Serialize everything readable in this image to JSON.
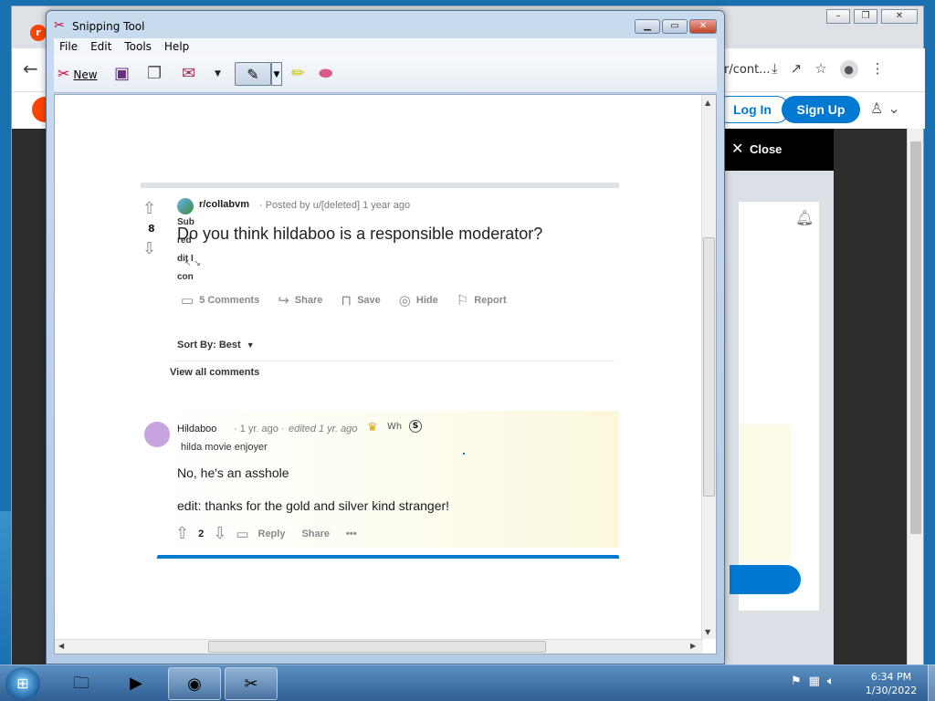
{
  "browser": {
    "url_tail": "r/cont...",
    "login_label": "Log In",
    "signup_label": "Sign Up",
    "close_label": "Close",
    "reddit_favicon": "reddit-logo-icon"
  },
  "snipping_tool": {
    "title": "Snipping Tool",
    "menu": [
      "File",
      "Edit",
      "Tools",
      "Help"
    ],
    "toolbar": {
      "new_label": "New"
    }
  },
  "post": {
    "score": "8",
    "subreddit": "r/collabvm",
    "subreddit_icon_alt": "Subreddit Icon",
    "meta": "· Posted by u/[deleted] 1 year ago",
    "title": "Do you think hildaboo is a responsible moderator?",
    "actions": {
      "comments": "5 Comments",
      "share": "Share",
      "save": "Save",
      "hide": "Hide",
      "report": "Report"
    },
    "sort_label": "Sort By: Best",
    "view_all": "View all comments"
  },
  "comment": {
    "author": "Hildaboo",
    "time": "· 1 yr. ago ·",
    "edited": "edited 1 yr. ago",
    "award_img_alt": "Wh",
    "award_silver": "S",
    "flair": "hilda movie enjoyer",
    "body_line1": "No, he's an asshole",
    "body_line2": "edit: thanks for the gold and silver kind stranger!",
    "score": "2",
    "reply": "Reply",
    "share": "Share",
    "more": "•••"
  },
  "taskbar": {
    "time": "6:34 PM",
    "date": "1/30/2022"
  }
}
